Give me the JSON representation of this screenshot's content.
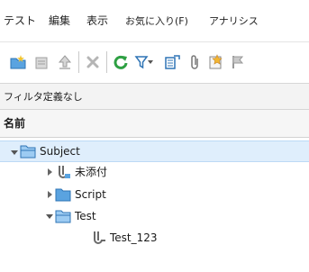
{
  "menu": {
    "items": [
      {
        "label": "テスト"
      },
      {
        "label": "編集"
      },
      {
        "label": "表示"
      },
      {
        "label": "お気に入り(F)"
      },
      {
        "label": "アナリシス"
      }
    ]
  },
  "toolbar": {
    "buttons": [
      {
        "icon": "new-folder-icon"
      },
      {
        "icon": "new-test-icon"
      },
      {
        "icon": "move-up-icon"
      },
      {
        "icon": "delete-icon"
      },
      {
        "icon": "refresh-icon"
      },
      {
        "icon": "filter-icon"
      },
      {
        "icon": "copy-to-icon"
      },
      {
        "icon": "attachment-icon"
      },
      {
        "icon": "alert-icon"
      },
      {
        "icon": "flag-icon"
      }
    ]
  },
  "filter": {
    "text": "フィルタ定義なし"
  },
  "tree": {
    "header": "名前",
    "nodes": [
      {
        "label": "Subject",
        "icon": "folder-open-icon",
        "state": "expanded",
        "selected": true
      },
      {
        "label": "未添付",
        "icon": "unattached-tests-icon",
        "state": "collapsed"
      },
      {
        "label": "Script",
        "icon": "folder-icon",
        "state": "collapsed"
      },
      {
        "label": "Test",
        "icon": "folder-open-icon",
        "state": "expanded"
      },
      {
        "label": "Test_123",
        "icon": "test-icon",
        "state": "leaf"
      }
    ]
  },
  "colors": {
    "selection": "#dfeefc",
    "folder": "#5aa3e0",
    "refresh": "#2ea043"
  }
}
